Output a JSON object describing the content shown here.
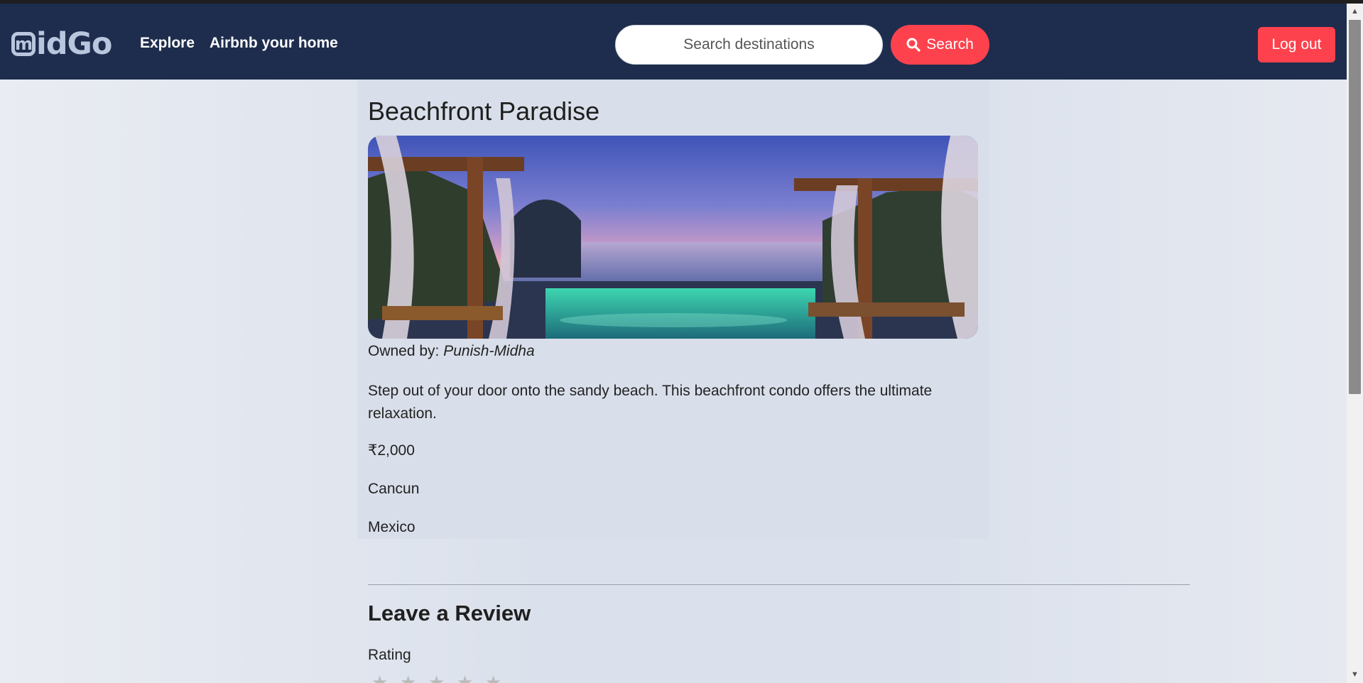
{
  "app": {
    "logo_text": "idGo",
    "logo_badge": "m"
  },
  "nav": {
    "explore": "Explore",
    "host": "Airbnb your home",
    "search_placeholder": "Search destinations",
    "search_button": "Search",
    "logout": "Log out"
  },
  "listing": {
    "title": "Beachfront Paradise",
    "owner_label": "Owned by:",
    "owner_name": "Punish-Midha",
    "description": "Step out of your door onto the sandy beach. This beachfront condo offers the ultimate relaxation.",
    "price": "₹2,000",
    "location": "Cancun",
    "country": "Mexico"
  },
  "review": {
    "heading": "Leave a Review",
    "rating_label": "Rating",
    "stars": [
      "★",
      "★",
      "★",
      "★",
      "★"
    ]
  },
  "colors": {
    "navbar": "#1e2d4d",
    "accent": "#fe424d",
    "logo": "#b9c6dd"
  },
  "icons": {
    "search": "magnifier-icon",
    "scroll_up": "▲",
    "scroll_down": "▼"
  }
}
